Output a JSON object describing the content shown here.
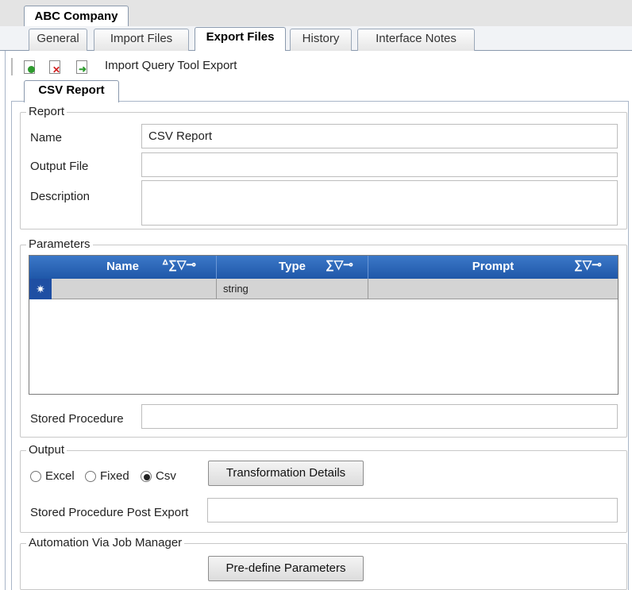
{
  "window_tab": "ABC Company",
  "tabs": [
    "General",
    "Import Files",
    "Export Files",
    "History",
    "Interface Notes"
  ],
  "toolbar": {
    "label": "Import Query Tool Export",
    "icons": [
      "add-document-icon",
      "delete-document-icon",
      "import-document-icon"
    ]
  },
  "sub_tab": "CSV Report",
  "report": {
    "legend": "Report",
    "name_label": "Name",
    "name_value": "CSV Report",
    "output_file_label": "Output File",
    "output_file_value": "",
    "description_label": "Description",
    "description_value": ""
  },
  "parameters": {
    "legend": "Parameters",
    "columns": [
      "Name",
      "Type",
      "Prompt"
    ],
    "name_col_icons": "ᐞ∑▽⊸",
    "type_col_icons": "∑▽⊸",
    "prompt_col_icons": "∑▽⊸",
    "new_row_marker": "✷",
    "new_row": {
      "name": "",
      "type": "string",
      "prompt": ""
    },
    "stored_procedure_label": "Stored Procedure",
    "stored_procedure_value": ""
  },
  "output": {
    "legend": "Output",
    "options": [
      "Excel",
      "Fixed",
      "Csv"
    ],
    "selected": "Csv",
    "transformation_button": "Transformation Details",
    "post_export_label": "Stored Procedure Post Export",
    "post_export_value": ""
  },
  "automation": {
    "legend": "Automation Via Job Manager",
    "predefine_button": "Pre-define Parameters"
  },
  "colors": {
    "grid_header": "#2a64b5",
    "new_row_marker_bg": "#1f4fa3"
  }
}
